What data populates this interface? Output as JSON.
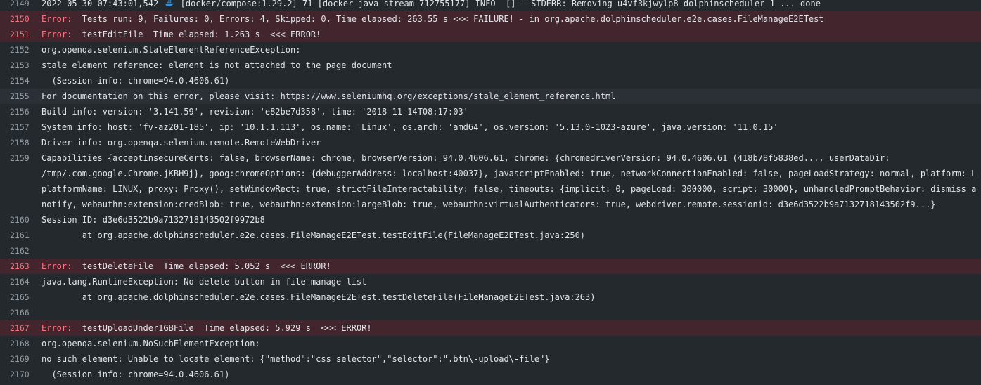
{
  "lines": [
    {
      "num": "2149",
      "pre": "2022-05-30 07:43:01,542 ",
      "post": " [docker/compose:1.29.2] 71 [docker-java-stream-712755177] INFO  [] - STDERR: Removing u4vf3kjwylp8_dolphinscheduler_1 ... done"
    },
    {
      "num": "2150",
      "label": "Error:",
      "text": "  Tests run: 9, Failures: 0, Errors: 4, Skipped: 0, Time elapsed: 263.55 s <<< FAILURE! - in org.apache.dolphinscheduler.e2e.cases.FileManageE2ETest"
    },
    {
      "num": "2151",
      "label": "Error:",
      "text": "  testEditFile  Time elapsed: 1.263 s  <<< ERROR!"
    },
    {
      "num": "2152",
      "text": "org.openqa.selenium.StaleElementReferenceException:"
    },
    {
      "num": "2153",
      "text": "stale element reference: element is not attached to the page document"
    },
    {
      "num": "2154",
      "text": "  (Session info: chrome=94.0.4606.61)"
    },
    {
      "num": "2155",
      "pre": "For documentation on this error, please visit: ",
      "link": "https://www.seleniumhq.org/exceptions/stale_element_reference.html"
    },
    {
      "num": "2156",
      "text": "Build info: version: '3.141.59', revision: 'e82be7d358', time: '2018-11-14T08:17:03'"
    },
    {
      "num": "2157",
      "text": "System info: host: 'fv-az201-185', ip: '10.1.1.113', os.name: 'Linux', os.arch: 'amd64', os.version: '5.13.0-1023-azure', java.version: '11.0.15'"
    },
    {
      "num": "2158",
      "text": "Driver info: org.openqa.selenium.remote.RemoteWebDriver"
    },
    {
      "num": "2159",
      "text": "Capabilities {acceptInsecureCerts: false, browserName: chrome, browserVersion: 94.0.4606.61, chrome: {chromedriverVersion: 94.0.4606.61 (418b78f5838ed..., userDataDir:"
    },
    {
      "num": "",
      "text": "/tmp/.com.google.Chrome.jKBH9j}, goog:chromeOptions: {debuggerAddress: localhost:40037}, javascriptEnabled: true, networkConnectionEnabled: false, pageLoadStrategy: normal, platform: L"
    },
    {
      "num": "",
      "text": "platformName: LINUX, proxy: Proxy(), setWindowRect: true, strictFileInteractability: false, timeouts: {implicit: 0, pageLoad: 300000, script: 30000}, unhandledPromptBehavior: dismiss a"
    },
    {
      "num": "",
      "text": "notify, webauthn:extension:credBlob: true, webauthn:extension:largeBlob: true, webauthn:virtualAuthenticators: true, webdriver.remote.sessionid: d3e6d3522b9a7132718143502f9...}"
    },
    {
      "num": "2160",
      "text": "Session ID: d3e6d3522b9a7132718143502f9972b8"
    },
    {
      "num": "2161",
      "text": "        at org.apache.dolphinscheduler.e2e.cases.FileManageE2ETest.testEditFile(FileManageE2ETest.java:250)"
    },
    {
      "num": "2162",
      "text": ""
    },
    {
      "num": "2163",
      "label": "Error:",
      "text": "  testDeleteFile  Time elapsed: 5.052 s  <<< ERROR!"
    },
    {
      "num": "2164",
      "text": "java.lang.RuntimeException: No delete button in file manage list"
    },
    {
      "num": "2165",
      "text": "        at org.apache.dolphinscheduler.e2e.cases.FileManageE2ETest.testDeleteFile(FileManageE2ETest.java:263)"
    },
    {
      "num": "2166",
      "text": ""
    },
    {
      "num": "2167",
      "label": "Error:",
      "text": "  testUploadUnder1GBFile  Time elapsed: 5.929 s  <<< ERROR!"
    },
    {
      "num": "2168",
      "text": "org.openqa.selenium.NoSuchElementException:"
    },
    {
      "num": "2169",
      "text": "no such element: Unable to locate element: {\"method\":\"css selector\",\"selector\":\".btn\\-upload\\-file\"}"
    },
    {
      "num": "2170",
      "text": "  (Session info: chrome=94.0.4606.61)"
    }
  ],
  "icon": "docker-whale-icon",
  "colors": {
    "background": "#24292e",
    "error_row": "#43262d",
    "error_text": "#f97583",
    "text": "#e1e4e8",
    "line_number": "#959da5"
  }
}
